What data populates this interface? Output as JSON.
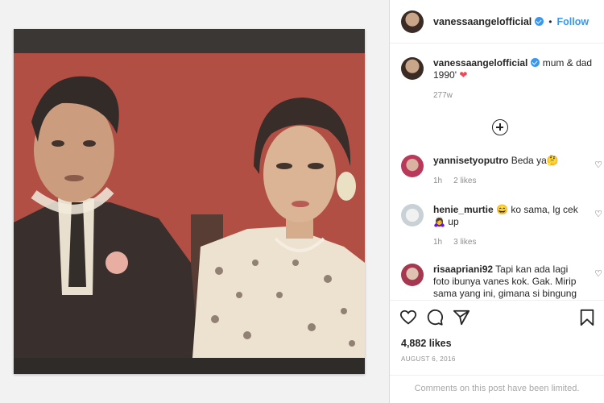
{
  "post": {
    "username": "vanessaangelofficial",
    "follow_label": "Follow",
    "separator": "•",
    "caption_text": "mum & dad 1990'",
    "caption_emoji": "❤",
    "caption_time": "277w",
    "likes": "4,882 likes",
    "date": "AUGUST 6, 2016",
    "comments_limited": "Comments on this post have been limited."
  },
  "comments": [
    {
      "username": "yannisetyoputro",
      "text": "Beda ya🤔",
      "time": "1h",
      "likes": "2 likes"
    },
    {
      "username": "henie_murtie",
      "text": "😄 ko sama, lg cek 🙇‍♀️ up",
      "time": "1h",
      "likes": "3 likes"
    },
    {
      "username": "risaapriani92",
      "text": "Tapi kan ada lagi foto ibunya vanes kok. Gak. Mirip sama yang ini, gimana si bingung"
    }
  ],
  "icons": {
    "heart": "heart-icon",
    "comment": "comment-icon",
    "share": "share-icon",
    "save": "bookmark-icon",
    "add": "add-comment-icon",
    "more": "more-icon"
  },
  "colors": {
    "accent": "#3897f0",
    "heart": "#ed4956"
  }
}
